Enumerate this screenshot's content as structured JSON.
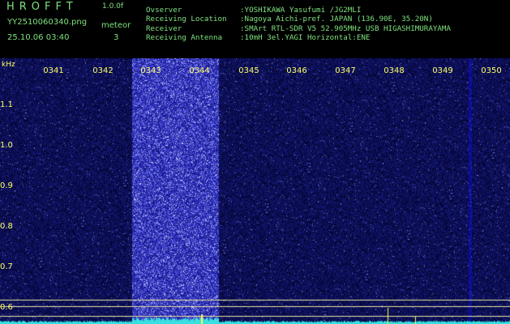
{
  "header": {
    "app_title": "HROFFT",
    "app_version": "1.0.0f",
    "file_name": "YY2510060340.png",
    "mode_label": "meteor",
    "date_time": "25.10.06 03:40",
    "meteor_count": "3"
  },
  "info": [
    {
      "key": "Ovserver",
      "value": ":YOSHIKAWA Yasufumi /JG2MLI"
    },
    {
      "key": "Receiving Location",
      "value": ":Nagoya Aichi-pref. JAPAN (136.90E, 35.20N)"
    },
    {
      "key": "Receiver",
      "value": ":SMArt RTL-SDR V5 52.905MHz USB HIGASHIMURAYAMA"
    },
    {
      "key": "Receiving Antenna",
      "value": ":10mH 3el.YAGI Horizontal:ENE"
    }
  ],
  "spectrogram": {
    "unit": "kHz",
    "time_labels": [
      "0341",
      "0342",
      "0343",
      "0344",
      "0345",
      "0346",
      "0347",
      "0348",
      "0349",
      "0350"
    ],
    "freq_labels": [
      "1.1",
      "1.0",
      "0.9",
      "0.8",
      "0.7",
      "0.6"
    ],
    "colors": {
      "background": "#0a0a50",
      "bright_band": "#2020c8",
      "guide_lines": "#e8e8a0",
      "trace": "#38e0e0",
      "text": "#ffff66"
    }
  }
}
